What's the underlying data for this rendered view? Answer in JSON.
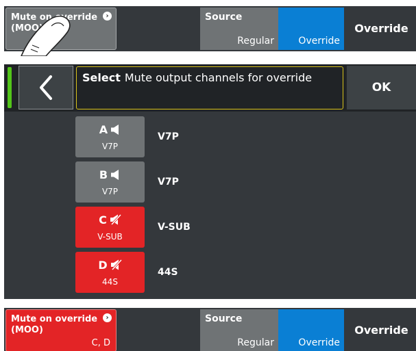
{
  "top_bar": {
    "moo_button": {
      "label": "Mute on override (MOO)",
      "value": ""
    },
    "source": {
      "label": "Source",
      "regular": "Regular",
      "override": "Override",
      "value": "Override"
    }
  },
  "dialog": {
    "select": "Select",
    "prompt": "Mute output channels for override",
    "ok": "OK",
    "channels": [
      {
        "letter": "A",
        "type": "V7P",
        "name": "V7P",
        "muted": false
      },
      {
        "letter": "B",
        "type": "V7P",
        "name": "V7P",
        "muted": false
      },
      {
        "letter": "C",
        "type": "V-SUB",
        "name": "V-SUB",
        "muted": true
      },
      {
        "letter": "D",
        "type": "44S",
        "name": "44S",
        "muted": true
      }
    ]
  },
  "bottom_bar": {
    "moo_button": {
      "label": "Mute on override (MOO)",
      "value": "C, D"
    },
    "source": {
      "label": "Source",
      "regular": "Regular",
      "override": "Override",
      "value": "Override"
    }
  },
  "colors": {
    "muted": "#e32426",
    "selected": "#0a7fd4",
    "inactive": "#6f7375",
    "panel": "#34383c",
    "focus": "#d9c31a",
    "status": "#52c41a"
  },
  "icons": {
    "info": "info-icon",
    "back": "chevron-left-icon",
    "speaker": "speaker-icon",
    "speaker_muted": "speaker-muted-icon",
    "touch": "touch-hand-icon"
  }
}
